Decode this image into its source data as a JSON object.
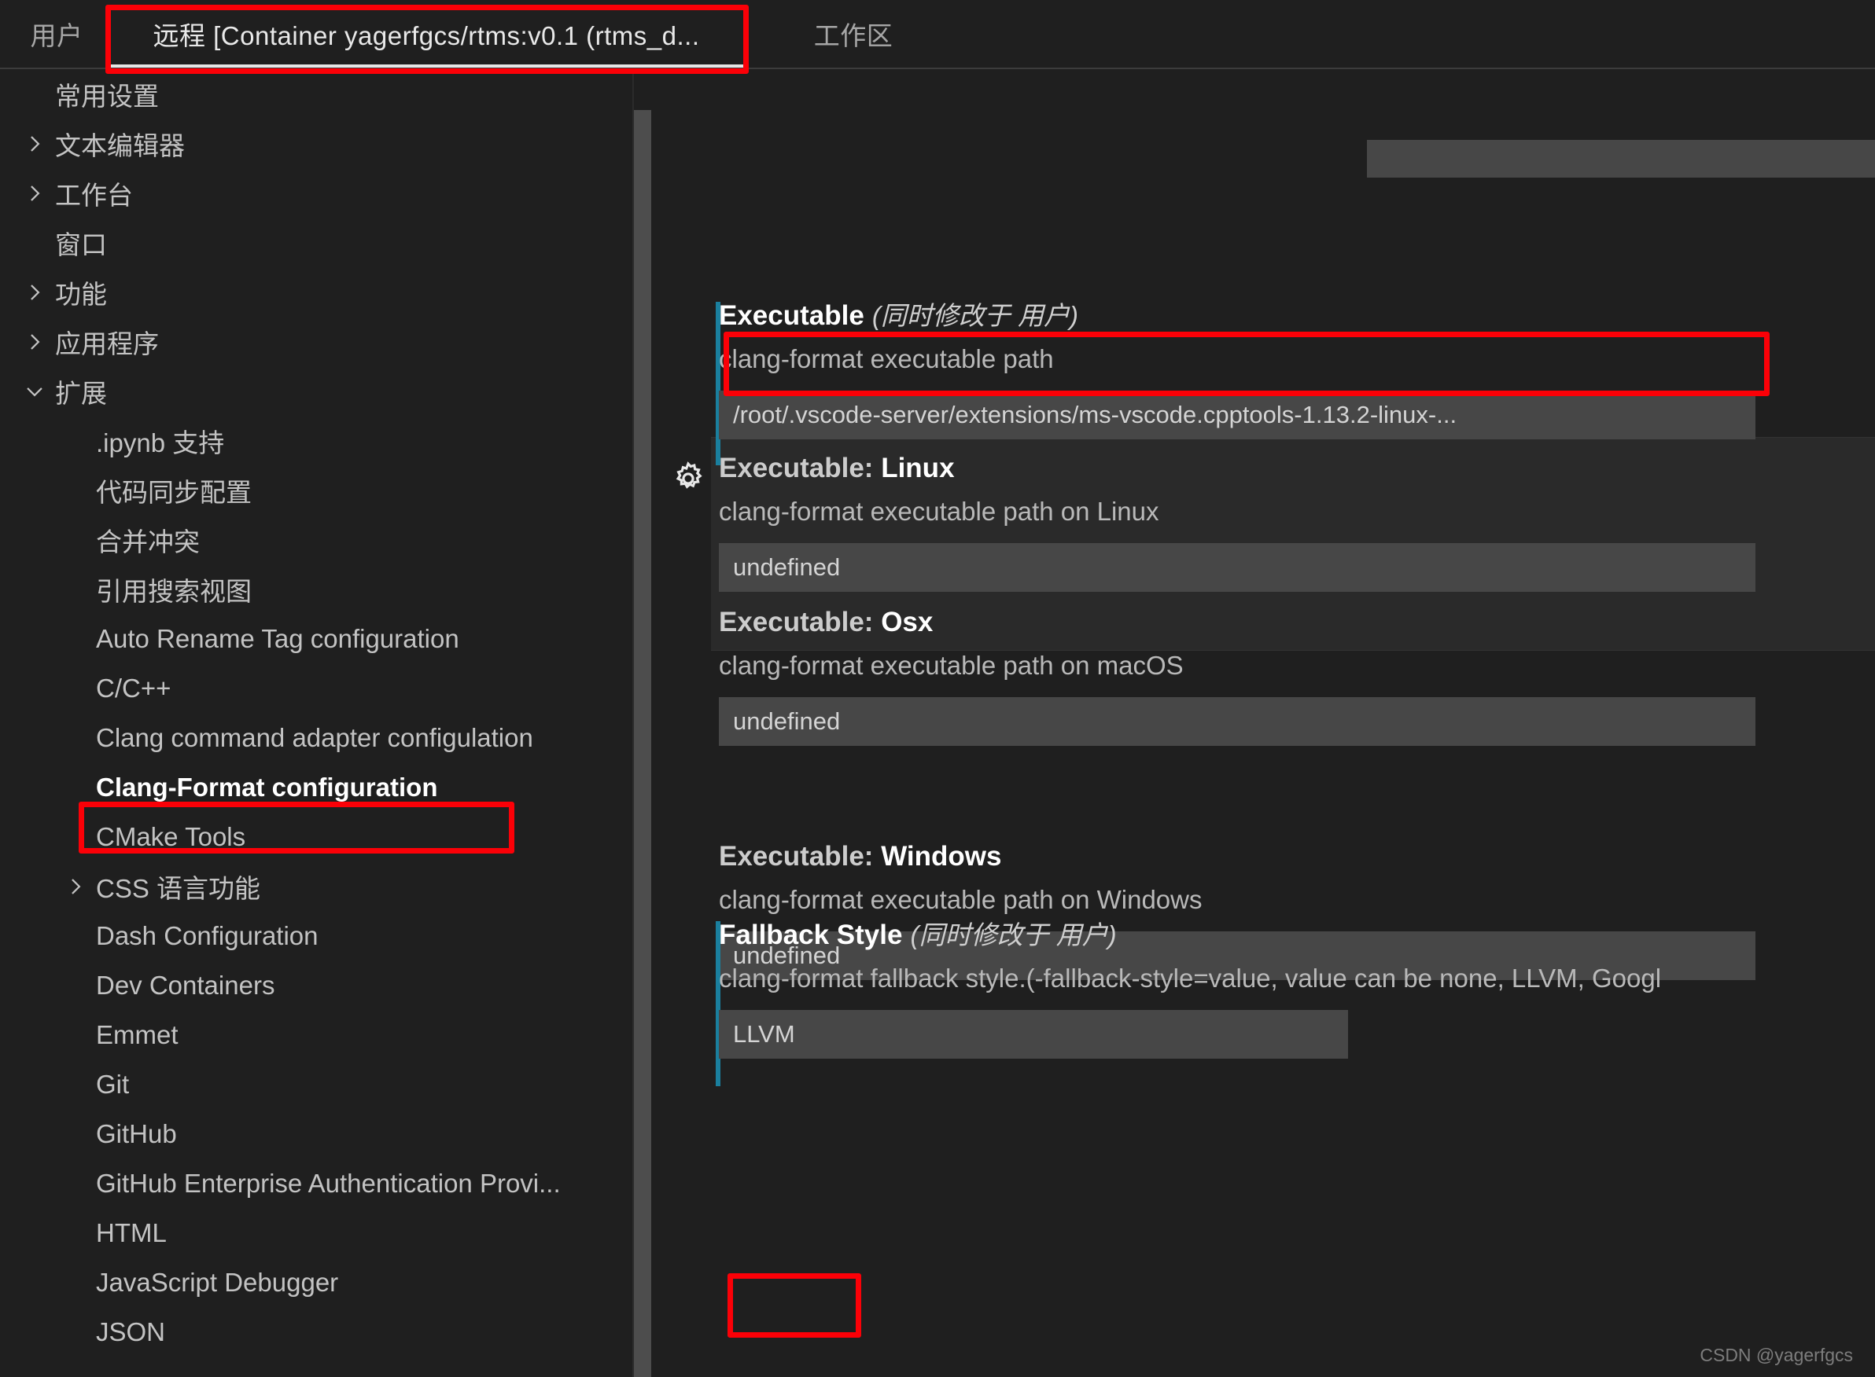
{
  "tabs": [
    {
      "id": "user",
      "label": "用户"
    },
    {
      "id": "remote",
      "label": "远程 [Container yagerfgcs/rtms:v0.1 (rtms_d..."
    },
    {
      "id": "workspace",
      "label": "工作区"
    }
  ],
  "sidebar": {
    "items": [
      {
        "label": "常用设置",
        "depth": 0,
        "twisty": "none",
        "selected": false
      },
      {
        "label": "文本编辑器",
        "depth": 0,
        "twisty": "collapsed",
        "selected": false
      },
      {
        "label": "工作台",
        "depth": 0,
        "twisty": "collapsed",
        "selected": false
      },
      {
        "label": "窗口",
        "depth": 0,
        "twisty": "none",
        "selected": false
      },
      {
        "label": "功能",
        "depth": 0,
        "twisty": "collapsed",
        "selected": false
      },
      {
        "label": "应用程序",
        "depth": 0,
        "twisty": "collapsed",
        "selected": false
      },
      {
        "label": "扩展",
        "depth": 0,
        "twisty": "expanded",
        "selected": false
      },
      {
        "label": ".ipynb 支持",
        "depth": 1,
        "twisty": "none",
        "selected": false
      },
      {
        "label": "代码同步配置",
        "depth": 1,
        "twisty": "none",
        "selected": false
      },
      {
        "label": "合并冲突",
        "depth": 1,
        "twisty": "none",
        "selected": false
      },
      {
        "label": "引用搜索视图",
        "depth": 1,
        "twisty": "none",
        "selected": false
      },
      {
        "label": "Auto Rename Tag configuration",
        "depth": 1,
        "twisty": "none",
        "selected": false
      },
      {
        "label": "C/C++",
        "depth": 1,
        "twisty": "none",
        "selected": false
      },
      {
        "label": "Clang command adapter configulation",
        "depth": 1,
        "twisty": "none",
        "selected": false
      },
      {
        "label": "Clang-Format configuration",
        "depth": 1,
        "twisty": "none",
        "selected": true
      },
      {
        "label": "CMake Tools",
        "depth": 1,
        "twisty": "none",
        "selected": false
      },
      {
        "label": "CSS 语言功能",
        "depth": 1,
        "twisty": "collapsed",
        "selected": false
      },
      {
        "label": "Dash Configuration",
        "depth": 1,
        "twisty": "none",
        "selected": false
      },
      {
        "label": "Dev Containers",
        "depth": 1,
        "twisty": "none",
        "selected": false
      },
      {
        "label": "Emmet",
        "depth": 1,
        "twisty": "none",
        "selected": false
      },
      {
        "label": "Git",
        "depth": 1,
        "twisty": "none",
        "selected": false
      },
      {
        "label": "GitHub",
        "depth": 1,
        "twisty": "none",
        "selected": false
      },
      {
        "label": "GitHub Enterprise Authentication Provi...",
        "depth": 1,
        "twisty": "none",
        "selected": false
      },
      {
        "label": "HTML",
        "depth": 1,
        "twisty": "none",
        "selected": false
      },
      {
        "label": "JavaScript Debugger",
        "depth": 1,
        "twisty": "none",
        "selected": false
      },
      {
        "label": "JSON",
        "depth": 1,
        "twisty": "none",
        "selected": false
      }
    ]
  },
  "settings": {
    "modified_note": "(同时修改于 用户)",
    "executable": {
      "title": "Executable",
      "note": "(同时修改于 用户)",
      "description": "clang-format executable path",
      "value": "/root/.vscode-server/extensions/ms-vscode.cpptools-1.13.2-linux-...",
      "modified": true
    },
    "executable_linux": {
      "title_prefix": "Executable: ",
      "title_suffix": "Linux",
      "description": "clang-format executable path on Linux",
      "value": "undefined",
      "gear": "gear-icon",
      "modified": false
    },
    "executable_osx": {
      "title_prefix": "Executable: ",
      "title_suffix": "Osx",
      "description": "clang-format executable path on macOS",
      "value": "undefined",
      "modified": false
    },
    "executable_windows": {
      "title_prefix": "Executable: ",
      "title_suffix": "Windows",
      "description": "clang-format executable path on Windows",
      "value": "undefined",
      "modified": false
    },
    "fallback_style": {
      "title": "Fallback Style",
      "note": "(同时修改于 用户)",
      "description": "clang-format fallback style.(-fallback-style=value, value can be none, LLVM, Googl",
      "value": "LLVM",
      "modified": true
    }
  },
  "watermark": "CSDN @yagerfgcs",
  "colors": {
    "background": "#1f1f1f",
    "input_background": "#474747",
    "modified_indicator": "#1a7f9e",
    "annotation": "#fb0007",
    "text_primary": "#ffffff",
    "text_secondary": "#b9b9b9",
    "tab_active_underline": "#e6e6e6"
  }
}
